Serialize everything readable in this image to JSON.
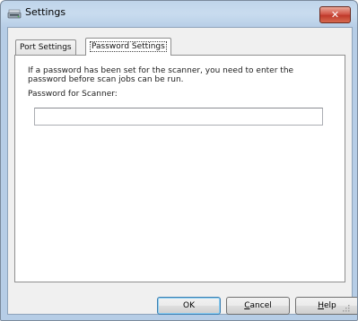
{
  "window": {
    "title": "Settings",
    "close_glyph": "✕",
    "app_icon": "scanner-icon"
  },
  "tabs": [
    {
      "label": "Port Settings",
      "selected": false
    },
    {
      "label": "Password Settings",
      "selected": true
    }
  ],
  "password_settings": {
    "description": "If a password has been set for the scanner, you need to enter the password before scan jobs can be run.",
    "field_label": "Password for Scanner:",
    "field_value": ""
  },
  "buttons": {
    "ok": "OK",
    "cancel_first": "C",
    "cancel_rest": "ancel",
    "help_first": "H",
    "help_rest": "elp"
  },
  "colors": {
    "close_button": "#c03a2b",
    "default_button_border": "#3c7fb1"
  }
}
